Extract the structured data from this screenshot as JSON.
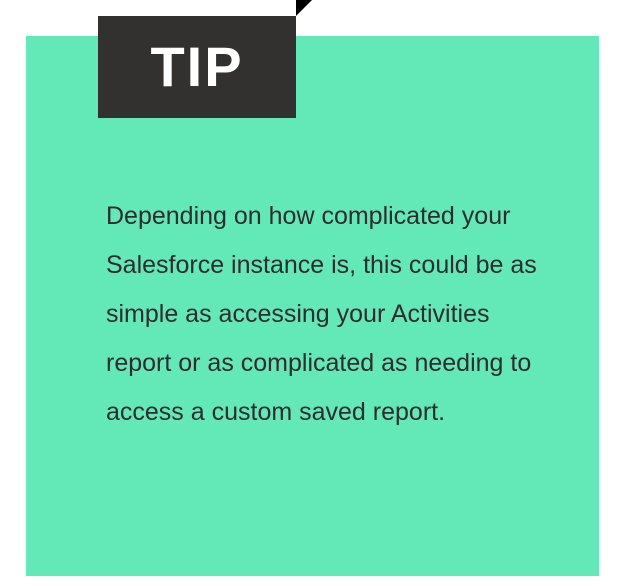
{
  "colors": {
    "panel": "#63e8b8",
    "badge": "#33312f",
    "badge_text": "#ffffff",
    "body_text": "#2d2d2d",
    "fold": "#000000"
  },
  "tip": {
    "label": "TIP",
    "body": "Depending on how complicated your Salesforce instance is, this could be as simple as accessing your Activities report or as complicated as needing to access a custom saved report."
  }
}
